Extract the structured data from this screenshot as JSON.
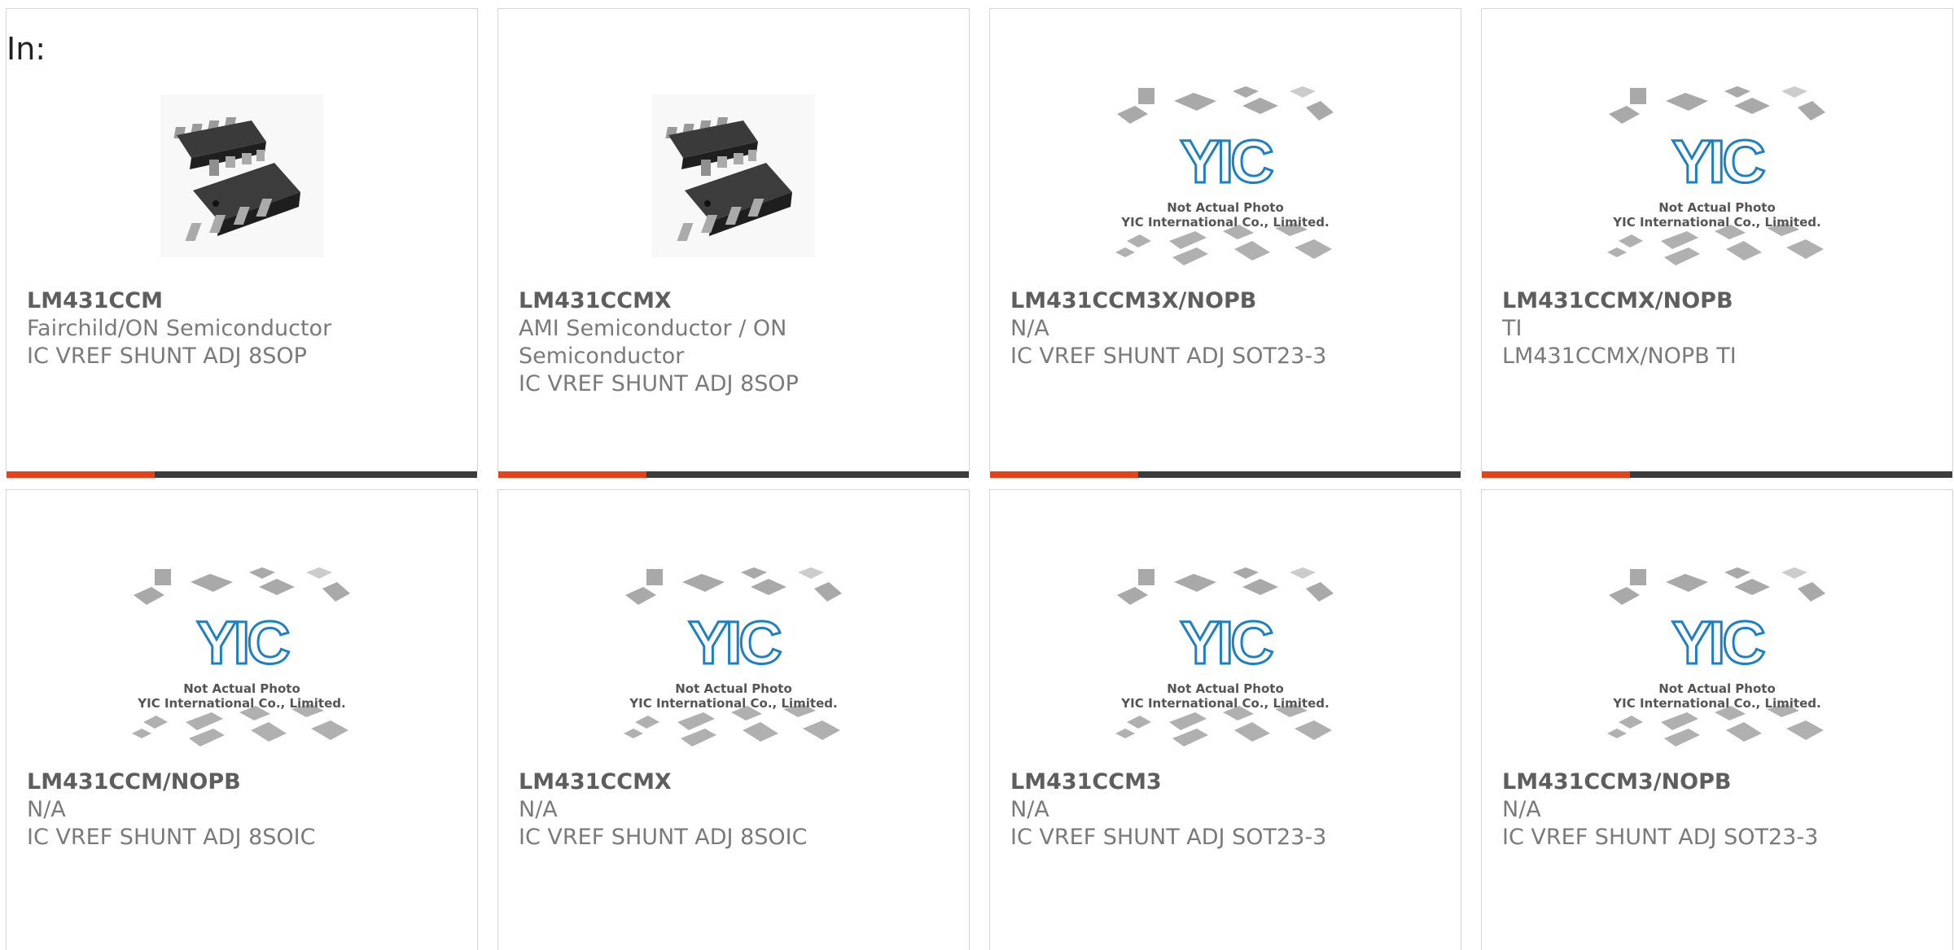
{
  "label": "In:",
  "accent_color": "#e8401b",
  "bar_color": "#3c3c3c",
  "cards": [
    {
      "part": "LM431CCM",
      "manufacturer": "Fairchild/ON Semiconductor",
      "description": "IC VREF SHUNT ADJ 8SOP",
      "image": "chip-photo-icon"
    },
    {
      "part": "LM431CCMX",
      "manufacturer": "AMI Semiconductor / ON Semiconductor",
      "description": "IC VREF SHUNT ADJ 8SOP",
      "image": "chip-photo-icon"
    },
    {
      "part": "LM431CCM3X/NOPB",
      "manufacturer": "N/A",
      "description": "IC VREF SHUNT ADJ SOT23-3",
      "image": "placeholder-logo-icon"
    },
    {
      "part": "LM431CCMX/NOPB",
      "manufacturer": "TI",
      "description": "LM431CCMX/NOPB TI",
      "image": "placeholder-logo-icon"
    },
    {
      "part": "LM431CCM/NOPB",
      "manufacturer": "N/A",
      "description": "IC VREF SHUNT ADJ 8SOIC",
      "image": "placeholder-logo-icon"
    },
    {
      "part": "LM431CCMX",
      "manufacturer": "N/A",
      "description": "IC VREF SHUNT ADJ 8SOIC",
      "image": "placeholder-logo-icon"
    },
    {
      "part": "LM431CCM3",
      "manufacturer": "N/A",
      "description": "IC VREF SHUNT ADJ SOT23-3",
      "image": "placeholder-logo-icon"
    },
    {
      "part": "LM431CCM3/NOPB",
      "manufacturer": "N/A",
      "description": "IC VREF SHUNT ADJ SOT23-3",
      "image": "placeholder-logo-icon"
    }
  ],
  "placeholder": {
    "logo_text": "YIC",
    "line1": "Not Actual Photo",
    "line2": "YIC International Co., Limited."
  }
}
